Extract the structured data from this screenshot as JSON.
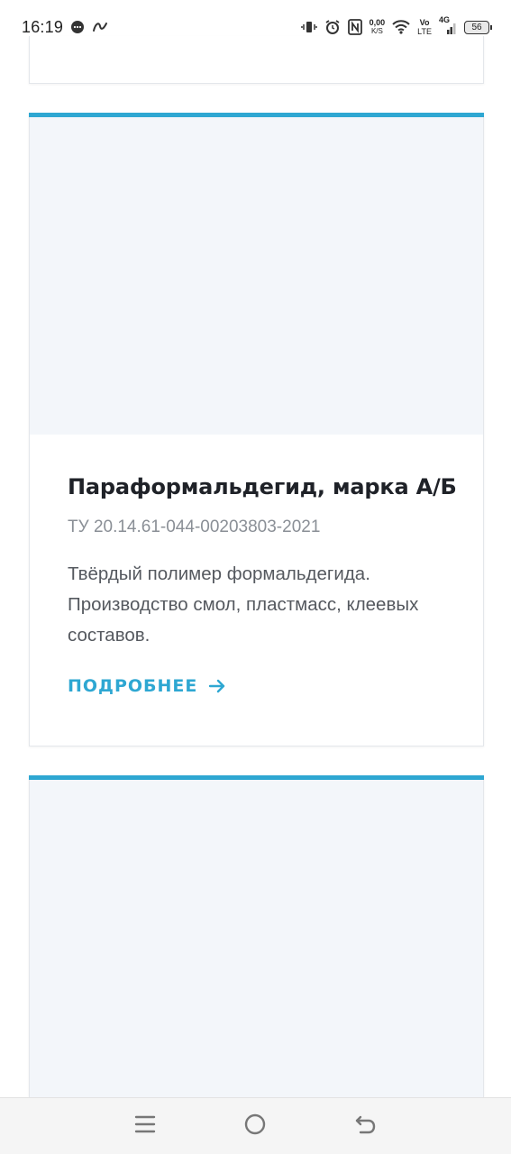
{
  "status_bar": {
    "time": "16:19",
    "net_speed_value": "0,00",
    "net_speed_unit": "K/S",
    "volte_top": "Vo",
    "volte_bottom": "LTE",
    "network": "4G",
    "battery": "56",
    "icons": [
      "message-icon",
      "pencil-icon",
      "vibrate-icon",
      "alarm-icon",
      "nfc-icon",
      "wifi-icon",
      "signal-icon",
      "battery-icon"
    ]
  },
  "product": {
    "title": "Параформальдегид, марка А/Б",
    "spec": "ТУ 20.14.61-044-00203803-2021",
    "description": "Твёрдый полимер формальдегида. Производство смол, пластмасс, клеевых составов.",
    "link_label": "ПОДРОБНЕЕ"
  },
  "colors": {
    "accent": "#2ea7d2",
    "image_placeholder": "#f3f6fa",
    "title": "#1f2228",
    "muted": "#8a8f96",
    "body_text": "#55595f"
  },
  "nav_bar": {
    "buttons": [
      "menu-icon",
      "home-icon",
      "back-icon"
    ]
  }
}
